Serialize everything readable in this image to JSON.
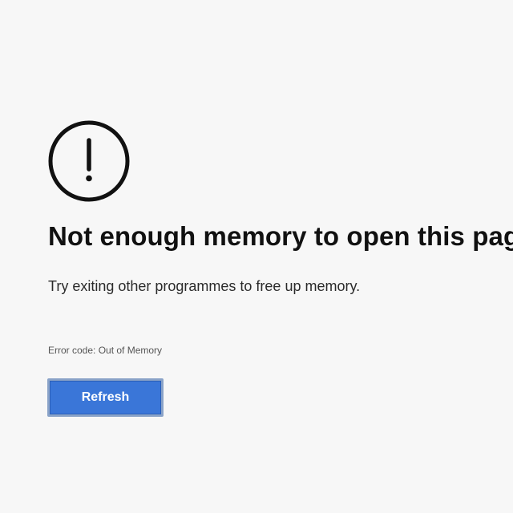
{
  "error": {
    "icon": "exclamation-circle-icon",
    "title": "Not enough memory to open this page",
    "message": "Try exiting other programmes to free up memory.",
    "code_text": "Error code: Out of Memory"
  },
  "actions": {
    "refresh_label": "Refresh"
  },
  "colors": {
    "background": "#f7f7f7",
    "button": "#3a76d8",
    "text": "#111111"
  }
}
